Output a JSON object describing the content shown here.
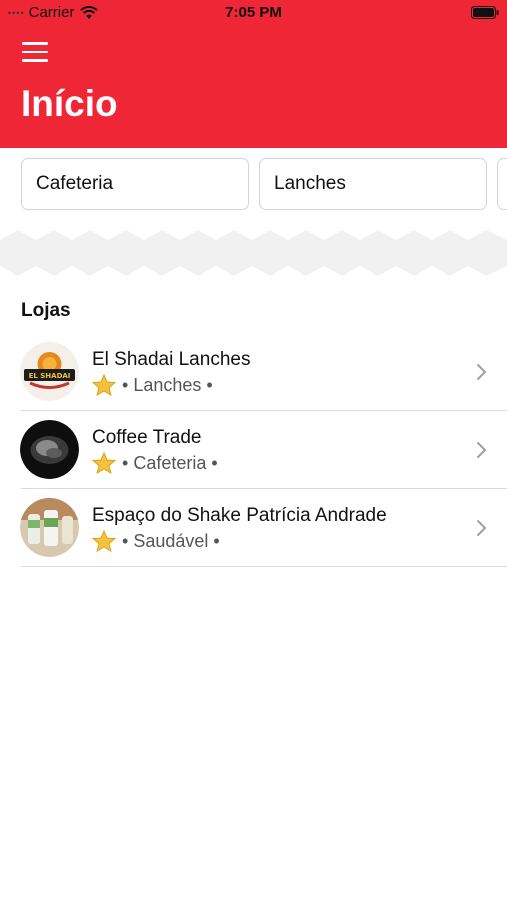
{
  "status_bar": {
    "carrier": "Carrier",
    "time": "7:05 PM",
    "signal_dots": "••••"
  },
  "header": {
    "title": "Início",
    "background_color": "#ee2636",
    "menu_icon": "hamburger-menu-icon"
  },
  "categories": [
    {
      "label": "Cafeteria"
    },
    {
      "label": "Lanches"
    },
    {
      "label": ""
    }
  ],
  "stores_section": {
    "title": "Lojas",
    "items": [
      {
        "name": "El Shadai Lanches",
        "bullet": "•",
        "category": "Lanches",
        "trailing": "•",
        "logo_text": "EL SHADAI",
        "icon": "star-icon"
      },
      {
        "name": "Coffee Trade",
        "bullet": "•",
        "category": "Cafeteria",
        "trailing": "•",
        "icon": "star-icon"
      },
      {
        "name": "Espaço do Shake Patrícia Andrade",
        "bullet": "•",
        "category": "Saudável",
        "trailing": "•",
        "icon": "star-icon"
      }
    ]
  }
}
